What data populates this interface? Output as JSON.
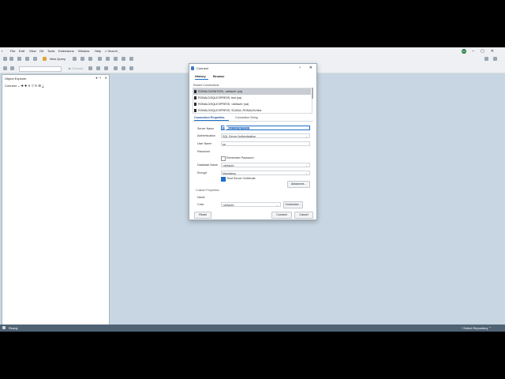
{
  "menubar": {
    "items": [
      "File",
      "Edit",
      "View",
      "Git",
      "Tools",
      "Extensions",
      "Window",
      "Help"
    ],
    "search": "Search"
  },
  "user_initials": "NK",
  "toolbar": {
    "new_query": "New Query",
    "execute": "Execute"
  },
  "object_explorer": {
    "title": "Object Explorer",
    "connect": "Connect"
  },
  "status": {
    "ready": "Ready",
    "repo": "Select Repository"
  },
  "dialog": {
    "title": "Connect",
    "help": "?",
    "close": "✕",
    "tabs": {
      "history": "History",
      "browse": "Browse"
    },
    "recent_label": "Recent Connections",
    "recent": [
      "RONALD\\IGNITION, <default> (sa)",
      "RONALD\\SQLEXPRESS, test (sa)",
      "RONALD\\SQLEXPRESS, <default> (sa)",
      "RONALD\\SQLEXPRESS, SCADA, RONALD\\rhine"
    ],
    "subtabs": {
      "props": "Connection Properties",
      "string": "Connection String"
    },
    "fields": {
      "server_label": "Server Name",
      "server_value": "RONALD\\IGNITION",
      "auth_label": "Authentication",
      "auth_value": "SQL Server Authentication",
      "user_label": "User Name",
      "user_value": "sa",
      "password_label": "Password",
      "remember": "Remember Password",
      "database_label": "Database Name",
      "database_value": "<default>",
      "encrypt_label": "Encrypt",
      "encrypt_value": "Mandatory",
      "trust": "Trust Server Certificate",
      "advanced": "Advanced...",
      "custom_label": "Custom Properties",
      "name_label": "Name",
      "color_label": "Color",
      "color_value": "<default>",
      "customize": "Customize..."
    },
    "buttons": {
      "reset": "Reset",
      "connect": "Connect",
      "cancel": "Cancel"
    }
  }
}
